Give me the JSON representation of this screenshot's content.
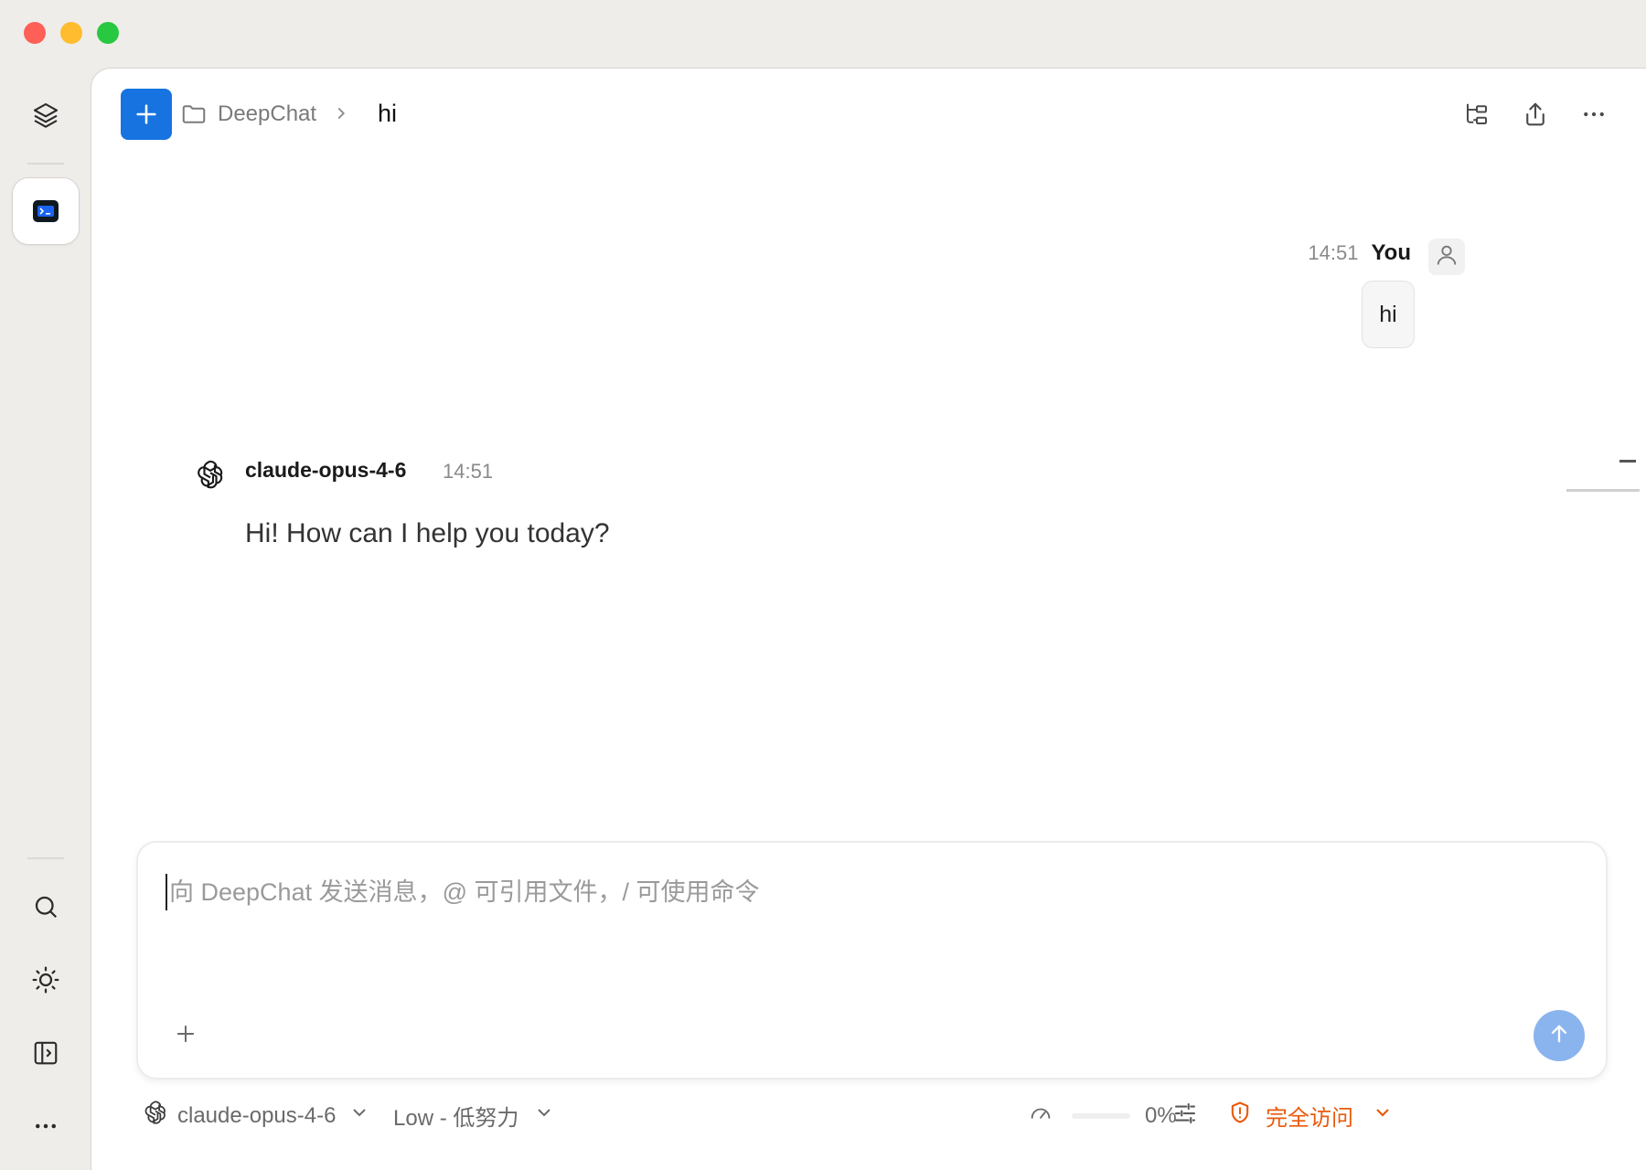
{
  "window": {
    "controls": [
      "close",
      "minimize",
      "maximize"
    ]
  },
  "rail": {
    "top_icon": "layers-icon",
    "active_app": "terminal-app-icon",
    "bottom_icons": [
      "search-icon",
      "sun-icon",
      "sidebar-toggle-icon",
      "more-icon"
    ]
  },
  "header": {
    "new_chat_icon": "plus-icon",
    "folder_icon": "folder-icon",
    "project": "DeepChat",
    "title": "hi",
    "actions": [
      "tree-icon",
      "share-icon",
      "more-horizontal-icon"
    ]
  },
  "messages": {
    "user": {
      "time": "14:51",
      "name": "You",
      "text": "hi"
    },
    "assistant": {
      "model": "claude-opus-4-6",
      "time": "14:51",
      "text": "Hi! How can I help you today?"
    }
  },
  "composer": {
    "placeholder": "向 DeepChat 发送消息，@ 可引用文件，/ 可使用命令",
    "value": ""
  },
  "footer": {
    "model_label": "claude-opus-4-6",
    "effort_label": "Low - 低努力",
    "context_percent_label": "0%",
    "context_fraction": 0,
    "access_label": "完全访问"
  },
  "colors": {
    "accent": "#1673e0",
    "send": "#8ab4ee",
    "access": "#ea5a0c"
  }
}
